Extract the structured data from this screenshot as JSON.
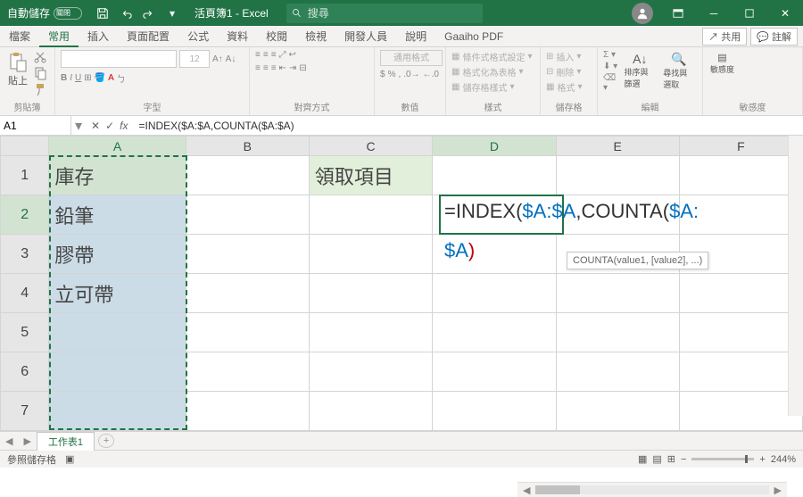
{
  "titlebar": {
    "autosave_label": "自動儲存",
    "autosave_state": "關閉",
    "doc_title": "活頁簿1 - Excel",
    "search_placeholder": "搜尋"
  },
  "tabs": {
    "items": [
      "檔案",
      "常用",
      "插入",
      "頁面配置",
      "公式",
      "資料",
      "校閱",
      "檢視",
      "開發人員",
      "說明",
      "Gaaiho PDF"
    ],
    "active_index": 1,
    "share_label": "共用",
    "comments_label": "註解"
  },
  "ribbon": {
    "clipboard": {
      "label": "剪貼簿",
      "paste": "貼上"
    },
    "font": {
      "label": "字型",
      "size": "12"
    },
    "alignment": {
      "label": "對齊方式"
    },
    "number": {
      "label": "數值",
      "format": "通用格式"
    },
    "styles": {
      "label": "樣式",
      "cond": "條件式格式設定",
      "table": "格式化為表格",
      "cell": "儲存格樣式"
    },
    "cells": {
      "label": "儲存格",
      "insert": "插入",
      "delete": "刪除",
      "format": "格式"
    },
    "editing": {
      "label": "編輯",
      "sort": "排序與篩選",
      "find": "尋找與選取"
    },
    "sensitivity": {
      "label": "敏感度",
      "btn": "敏感度"
    }
  },
  "formula_bar": {
    "cellref": "A1",
    "formula": "=INDEX($A:$A,COUNTA($A:$A)"
  },
  "columns": [
    "A",
    "B",
    "C",
    "D",
    "E",
    "F"
  ],
  "rows": [
    "1",
    "2",
    "3",
    "4",
    "5",
    "6",
    "7"
  ],
  "cells": {
    "A1": "庫存",
    "A2": "鉛筆",
    "A3": "膠帶",
    "A4": "立可帶",
    "C1": "領取項目"
  },
  "editing_overlay": {
    "prefix": "=INDEX(",
    "ref1": "$A:$A",
    "mid": ",COUNTA(",
    "ref2": "$A:",
    "ref2b": "$A",
    "suffix": ")"
  },
  "tooltip": "COUNTA(value1, [value2], ...)",
  "sheet_tabs": {
    "active": "工作表1"
  },
  "statusbar": {
    "mode": "參照儲存格",
    "zoom": "244%"
  }
}
